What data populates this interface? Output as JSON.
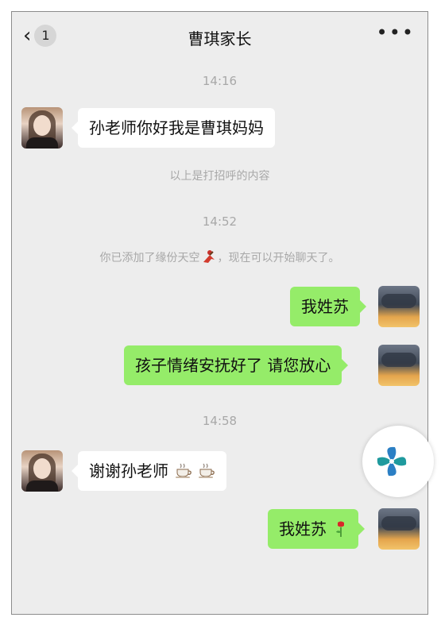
{
  "header": {
    "back_icon": "chevron-left-icon",
    "unread_count": "1",
    "title": "曹琪家长",
    "more_label": "•••"
  },
  "timestamps": [
    "14:16",
    "14:52",
    "14:58"
  ],
  "system": {
    "greeting_note": "以上是打招呼的内容",
    "friend_added": "你已添加了缘份天空",
    "friend_added_tail": "，现在可以开始聊天了。"
  },
  "messages": [
    {
      "side": "left",
      "text": "孙老师你好我是曹琪妈妈"
    },
    {
      "side": "right",
      "text": "我姓苏"
    },
    {
      "side": "right",
      "text": "孩子情绪安抚好了 请您放心"
    },
    {
      "side": "left",
      "text": "谢谢孙老师"
    },
    {
      "side": "right",
      "text": "我姓苏"
    }
  ],
  "colors": {
    "background": "#ededed",
    "bubble_self": "#95ec69",
    "bubble_other": "#ffffff",
    "meta_text": "#a8a8a8"
  }
}
